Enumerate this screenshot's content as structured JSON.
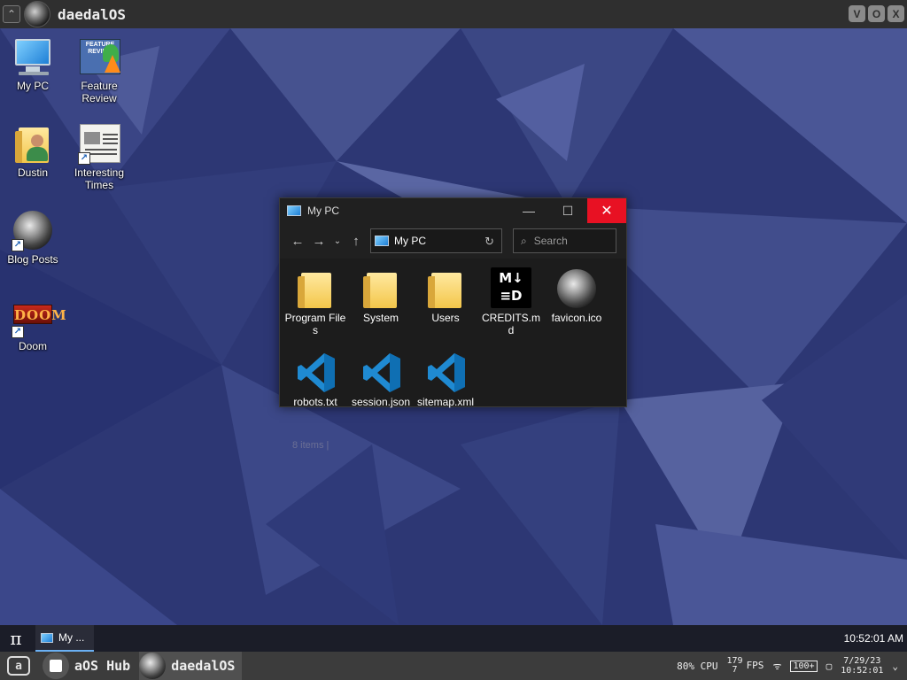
{
  "host": {
    "title": "daedalOS",
    "controls": [
      "V",
      "O",
      "X"
    ]
  },
  "desktop": {
    "icons": [
      {
        "label": "My PC"
      },
      {
        "label": "Feature Review",
        "thumb_text": "FEATURE REVIEW"
      },
      {
        "label": "Dustin"
      },
      {
        "label": "Interesting Times"
      },
      {
        "label": "Blog Posts"
      },
      {
        "label": "Doom",
        "thumb_text": "DOOM"
      }
    ]
  },
  "explorer": {
    "title": "My PC",
    "address": "My PC",
    "search_placeholder": "Search",
    "nav": {
      "back": "←",
      "forward": "→",
      "recent": "⌄",
      "up": "↑",
      "refresh": "↻"
    },
    "window_buttons": {
      "minimize": "—",
      "maximize": "☐",
      "close": "✕"
    },
    "files": [
      {
        "name": "Program Files",
        "type": "folder"
      },
      {
        "name": "System",
        "type": "folder"
      },
      {
        "name": "Users",
        "type": "folder"
      },
      {
        "name": "CREDITS.md",
        "type": "markdown"
      },
      {
        "name": "favicon.ico",
        "type": "icon"
      },
      {
        "name": "robots.txt",
        "type": "vscode"
      },
      {
        "name": "session.json",
        "type": "vscode"
      },
      {
        "name": "sitemap.xml",
        "type": "vscode"
      }
    ],
    "md_glyph_top": "M↓",
    "md_glyph_bottom": "≡D",
    "status": "8 items   |"
  },
  "taskbar": {
    "start_symbol": "π",
    "entry_label": "My ...",
    "clock": "10:52:01 AM"
  },
  "hostbar": {
    "logo": "a",
    "apps": [
      {
        "name": "aOS Hub"
      },
      {
        "name": "daedalOS"
      }
    ],
    "cpu": "80% CPU",
    "fps_top": "179",
    "fps_bottom": "7",
    "fps_label": "FPS",
    "wifi": "ᯤ",
    "battery": "100+",
    "chat": "▢",
    "date": "7/29/23",
    "time": "10:52:01",
    "menu": "⌄"
  }
}
